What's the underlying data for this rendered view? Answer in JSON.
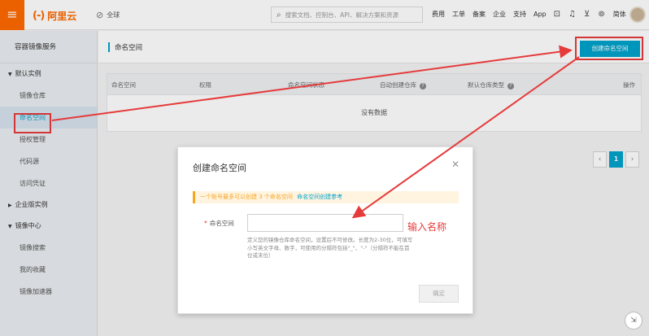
{
  "topbar": {
    "logo_mark": "(-)",
    "logo_name": "阿里云",
    "region": "全球",
    "search_placeholder": "搜索文档、控制台、API、解决方案和资源",
    "nav": [
      "费用",
      "工单",
      "备案",
      "企业",
      "支持",
      "App"
    ],
    "language": "简体"
  },
  "sidebar": {
    "title": "容器镜像服务",
    "groups": [
      {
        "label": "默认实例",
        "expanded": true,
        "items": [
          "镜像仓库",
          "命名空间",
          "授权管理",
          "代码源",
          "访问凭证"
        ]
      },
      {
        "label": "企业版实例",
        "expanded": false,
        "items": []
      },
      {
        "label": "镜像中心",
        "expanded": true,
        "items": [
          "镜像搜索",
          "我的收藏",
          "镜像加速器"
        ]
      }
    ],
    "active_item": "命名空间"
  },
  "page": {
    "title": "命名空间",
    "create_button": "创建命名空间"
  },
  "table": {
    "columns": [
      "命名空间",
      "权限",
      "命名空间状态",
      "自动创建仓库",
      "默认仓库类型",
      "操作"
    ],
    "empty_text": "没有数据"
  },
  "pagination": {
    "current": "1",
    "prev": "‹",
    "next": "›"
  },
  "dialog": {
    "title": "创建命名空间",
    "notice_text": "一个账号最多可以创建 3 个命名空间",
    "notice_link": "命名空间创建参考",
    "field_label": "命名空间",
    "field_value": "",
    "hint": "定义您的镜像仓库命名空间，设置后不可修改。长度为2-30位，可填写小写英文字母、数字，可使用的分隔符包括\"_\"、\"-\"（分隔符不能在首位或末位）",
    "ok_button": "确定"
  },
  "annotation": "输入名称",
  "colors": {
    "accent": "#00a2ca",
    "brand": "#ff6a00",
    "annotation": "#e53b3b"
  }
}
